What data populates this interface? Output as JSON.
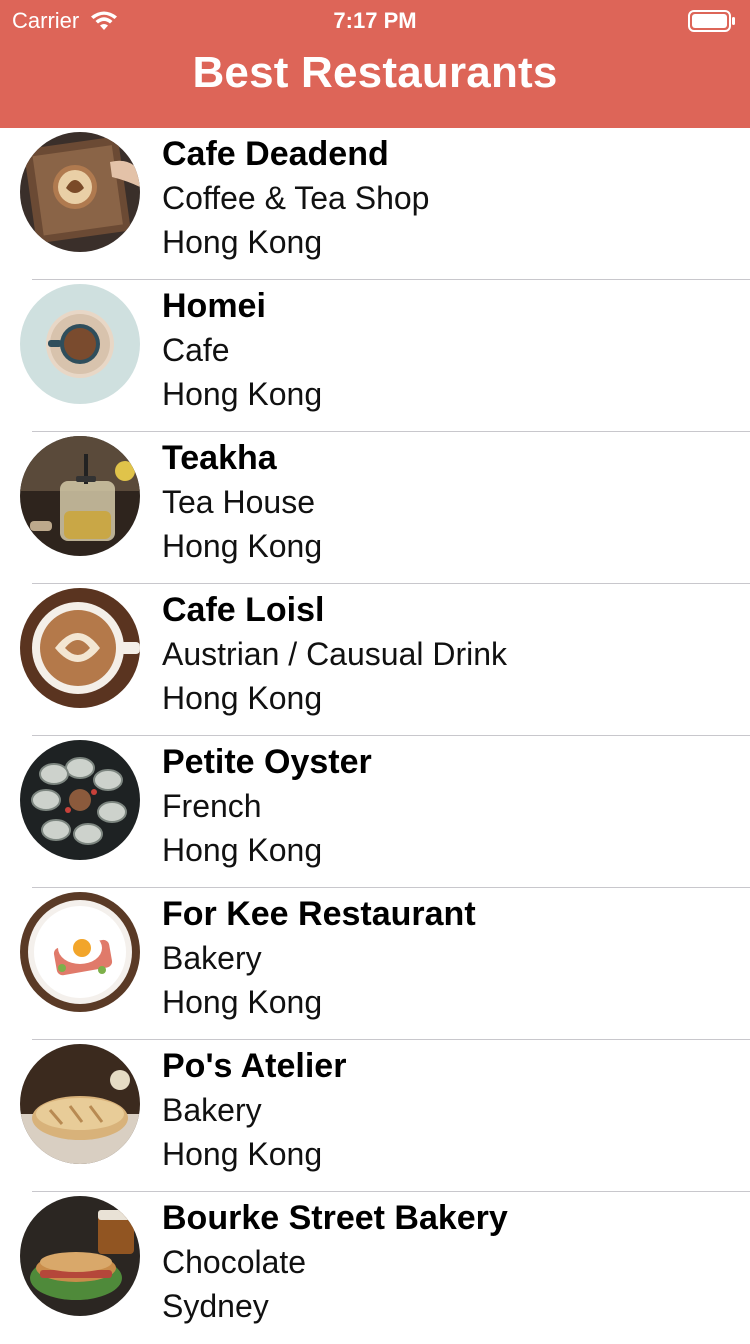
{
  "status_bar": {
    "carrier": "Carrier",
    "time": "7:17 PM"
  },
  "nav": {
    "title": "Best Restaurants"
  },
  "colors": {
    "nav_bg": "#dd6558",
    "separator": "#c8c7cc"
  },
  "restaurants": [
    {
      "name": "Cafe Deadend",
      "type": "Coffee & Tea Shop",
      "location": "Hong Kong",
      "image": "latte-tray-photo"
    },
    {
      "name": "Homei",
      "type": "Cafe",
      "location": "Hong Kong",
      "image": "cup-on-saucer-photo"
    },
    {
      "name": "Teakha",
      "type": "Tea House",
      "location": "Hong Kong",
      "image": "teapot-photo"
    },
    {
      "name": "Cafe Loisl",
      "type": "Austrian / Causual Drink",
      "location": "Hong Kong",
      "image": "latte-art-photo"
    },
    {
      "name": "Petite Oyster",
      "type": "French",
      "location": "Hong Kong",
      "image": "oysters-photo"
    },
    {
      "name": "For Kee Restaurant",
      "type": "Bakery",
      "location": "Hong Kong",
      "image": "fried-egg-plate-photo"
    },
    {
      "name": "Po's Atelier",
      "type": "Bakery",
      "location": "Hong Kong",
      "image": "bread-loaf-photo"
    },
    {
      "name": "Bourke Street Bakery",
      "type": "Chocolate",
      "location": "Sydney",
      "image": "sandwich-photo"
    }
  ]
}
